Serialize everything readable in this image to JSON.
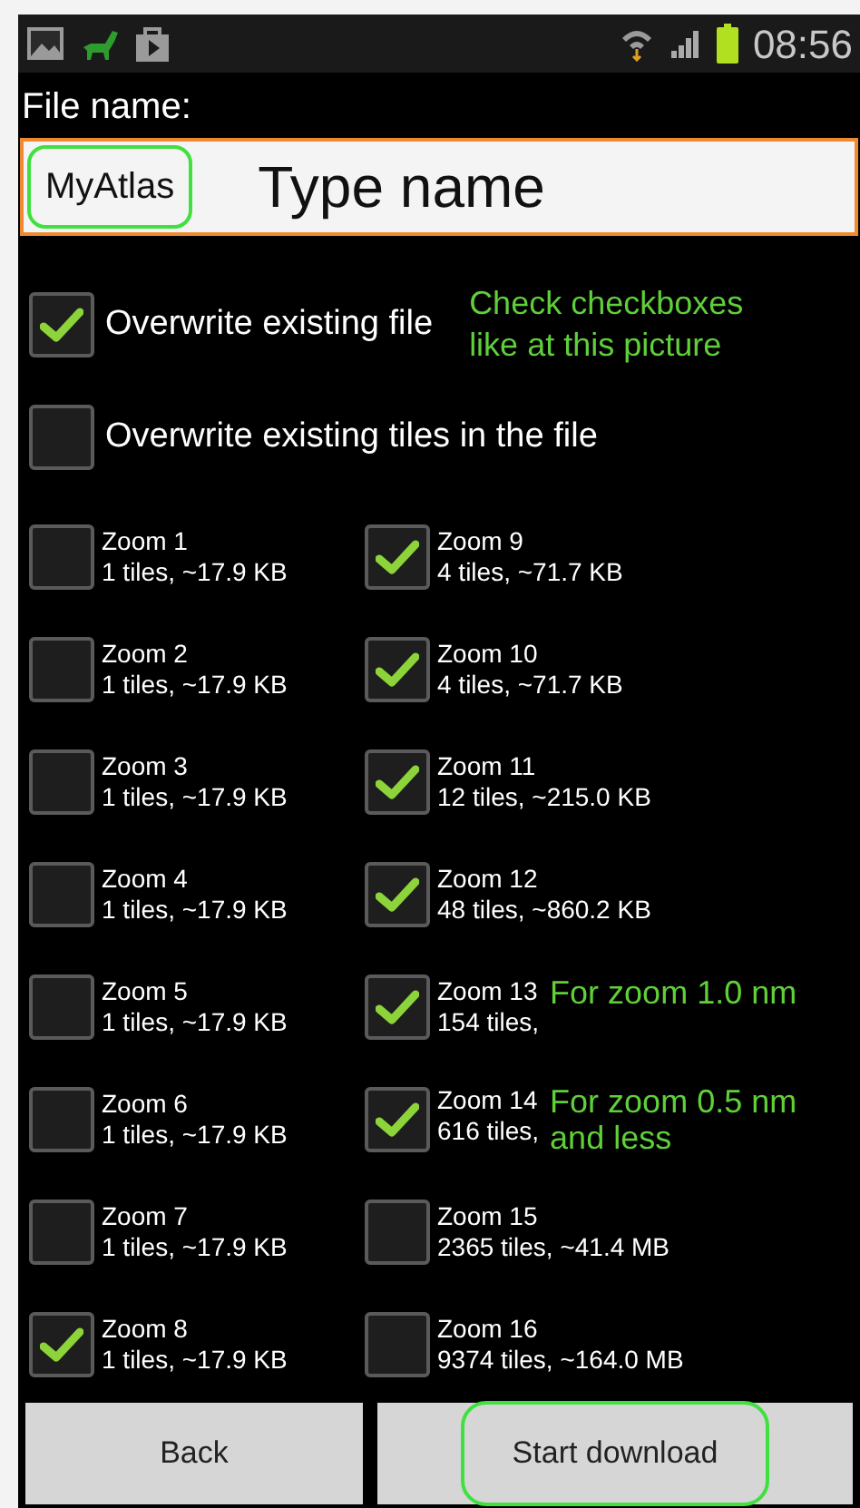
{
  "status_bar": {
    "time": "08:56"
  },
  "file_name": {
    "label": "File name:",
    "value": "MyAtlas",
    "value_highlighted": true,
    "hint_note": "Type name"
  },
  "options": [
    {
      "label": "Overwrite existing file",
      "checked": true,
      "note": "Check checkboxes like at this picture"
    },
    {
      "label": "Overwrite existing tiles in the file",
      "checked": false
    }
  ],
  "zoom_levels": [
    {
      "label": "Zoom 1",
      "info": "1 tiles, ~17.9 KB",
      "checked": false
    },
    {
      "label": "Zoom 2",
      "info": "1 tiles, ~17.9 KB",
      "checked": false
    },
    {
      "label": "Zoom 3",
      "info": "1 tiles, ~17.9 KB",
      "checked": false
    },
    {
      "label": "Zoom 4",
      "info": "1 tiles, ~17.9 KB",
      "checked": false
    },
    {
      "label": "Zoom 5",
      "info": "1 tiles, ~17.9 KB",
      "checked": false
    },
    {
      "label": "Zoom 6",
      "info": "1 tiles, ~17.9 KB",
      "checked": false
    },
    {
      "label": "Zoom 7",
      "info": "1 tiles, ~17.9 KB",
      "checked": false
    },
    {
      "label": "Zoom 8",
      "info": "1 tiles, ~17.9 KB",
      "checked": true
    },
    {
      "label": "Zoom 9",
      "info": "4 tiles, ~71.7 KB",
      "checked": true
    },
    {
      "label": "Zoom 10",
      "info": "4 tiles, ~71.7 KB",
      "checked": true
    },
    {
      "label": "Zoom 11",
      "info": "12 tiles, ~215.0 KB",
      "checked": true
    },
    {
      "label": "Zoom 12",
      "info": "48 tiles, ~860.2 KB",
      "checked": true
    },
    {
      "label": "Zoom 13",
      "info": "154 tiles,",
      "checked": true,
      "note": "For zoom 1.0 nm"
    },
    {
      "label": "Zoom 14",
      "info": "616 tiles,",
      "checked": true,
      "note": "For zoom 0.5 nm and less"
    },
    {
      "label": "Zoom 15",
      "info": "2365 tiles, ~41.4 MB",
      "checked": false
    },
    {
      "label": "Zoom 16",
      "info": "9374 tiles, ~164.0 MB",
      "checked": false
    }
  ],
  "buttons": [
    {
      "label": "Back",
      "highlighted": false
    },
    {
      "label": "Start download",
      "highlighted": true
    }
  ]
}
